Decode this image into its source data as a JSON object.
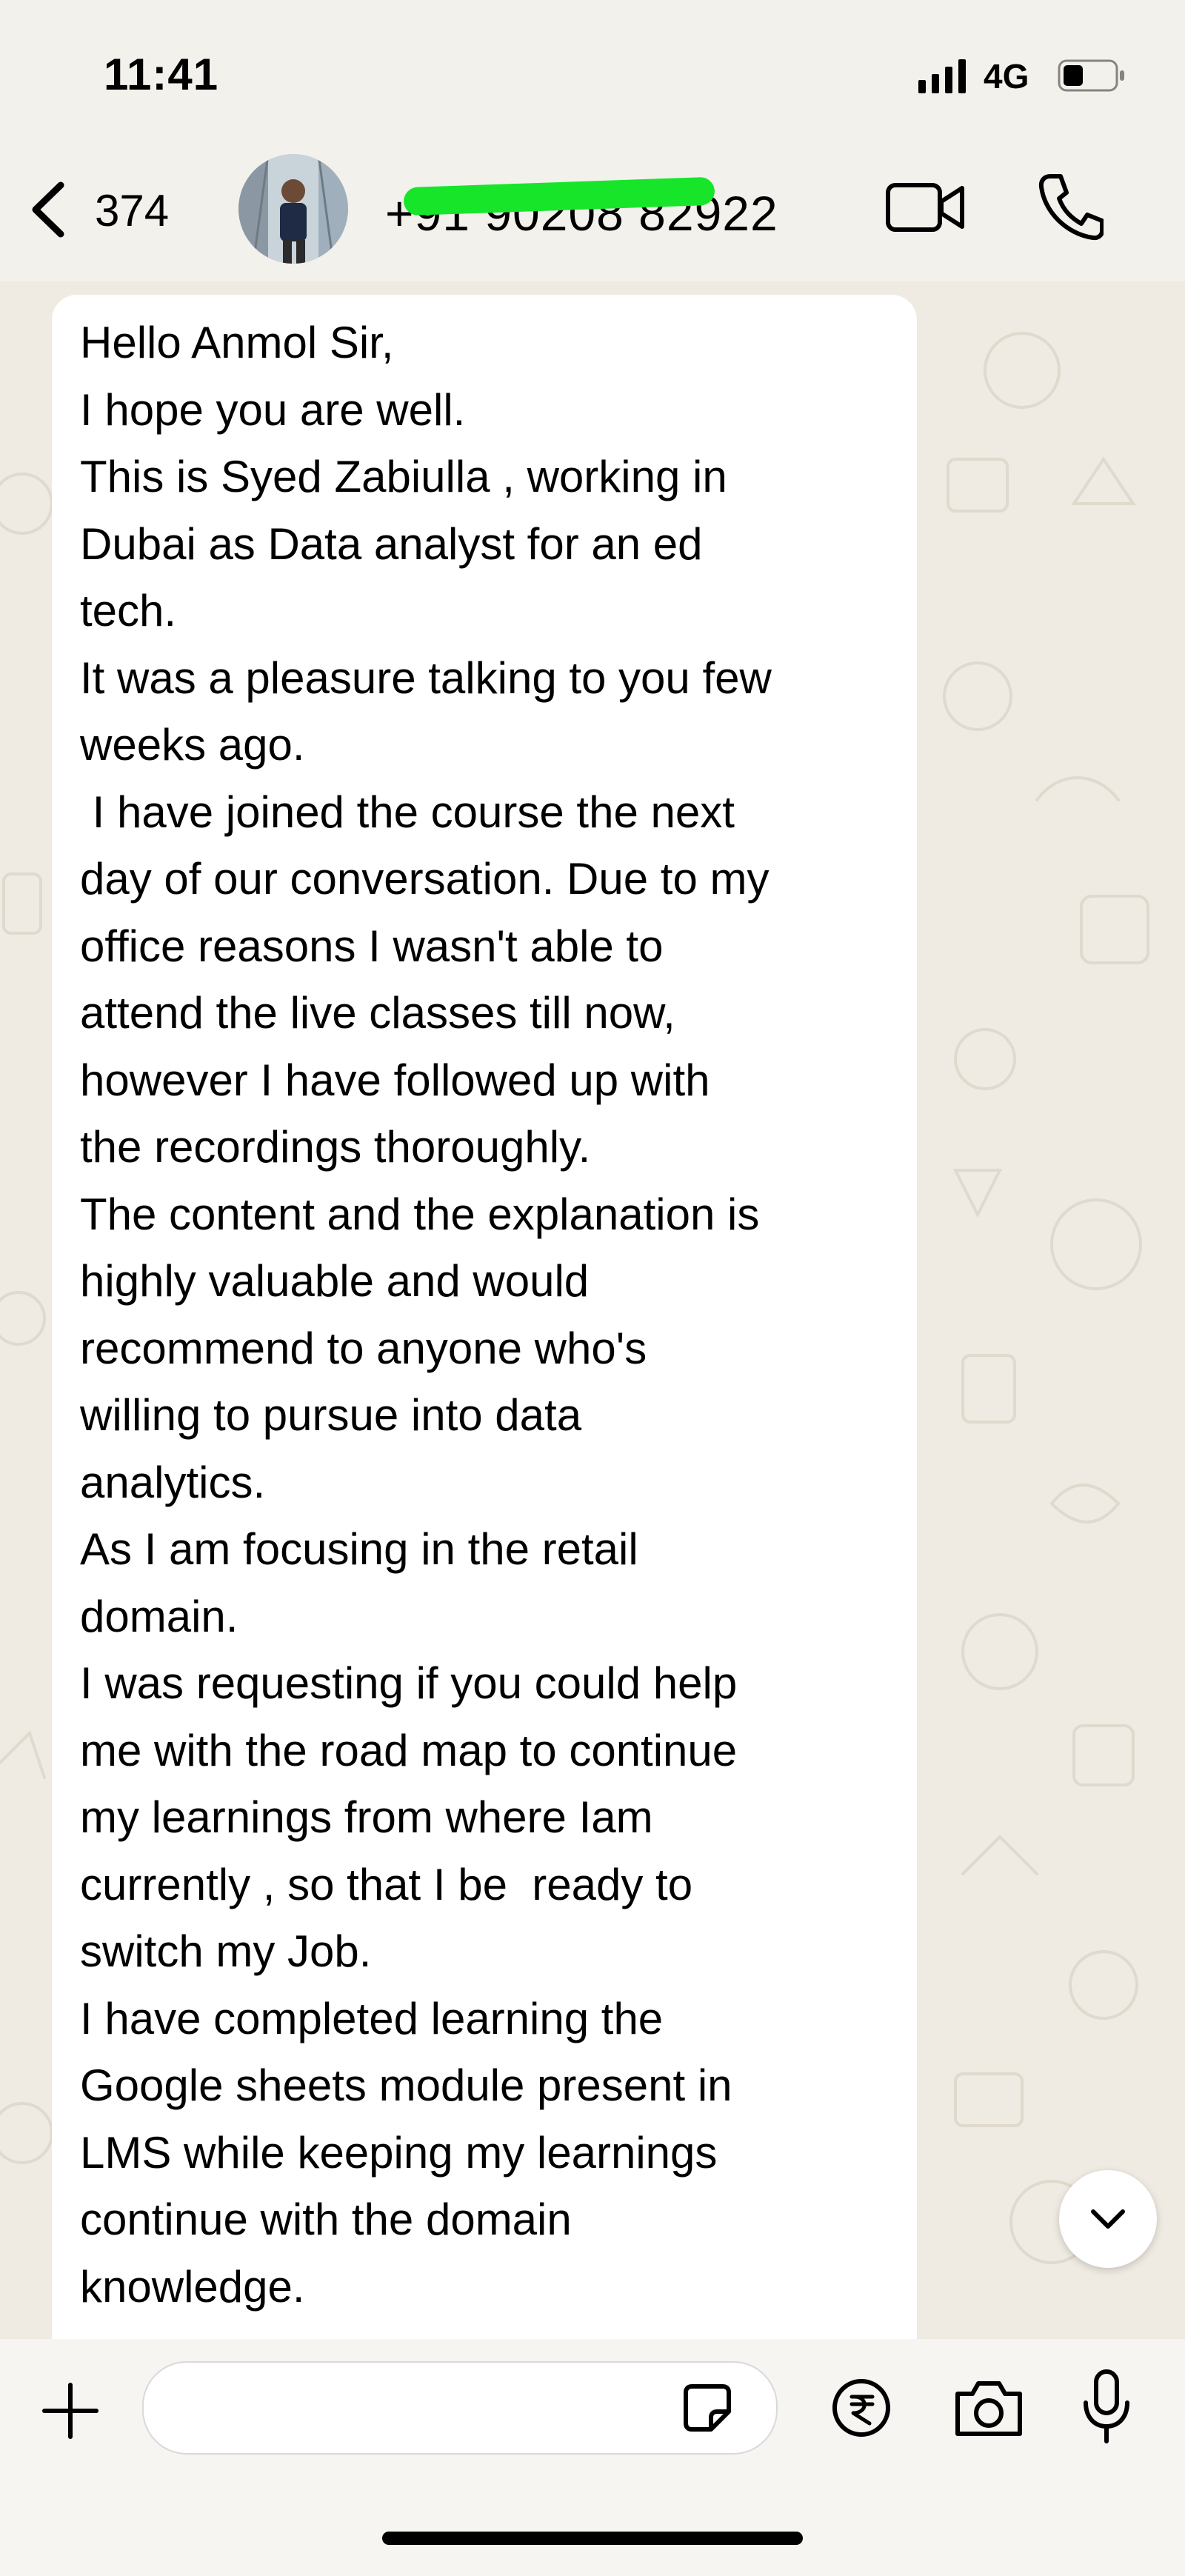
{
  "status_bar": {
    "time": "11:41",
    "network": "4G",
    "icons": [
      "signal-icon",
      "battery-icon"
    ]
  },
  "chat_header": {
    "unread_count": "374",
    "contact_phone": "+91 90208 82922",
    "icons": [
      "back-chevron-icon",
      "video-call-icon",
      "voice-call-icon"
    ]
  },
  "message": {
    "text": "Hello Anmol Sir,\nI hope you are well.\nThis is Syed Zabiulla , working in\nDubai as Data analyst for an ed\ntech.\nIt was a pleasure talking to you few\nweeks ago.\n I have joined the course the next\nday of our conversation. Due to my\noffice reasons I wasn't able to\nattend the live classes till now,\nhowever I have followed up with\nthe recordings thoroughly.\nThe content and the explanation is\nhighly valuable and would\nrecommend to anyone who's\nwilling to pursue into data\nanalytics.\nAs I am focusing in the retail\ndomain.\nI was requesting if you could help\nme with the road map to continue\nmy learnings from where Iam\ncurrently , so that I be  ready to\nswitch my Job.\nI have completed learning the\nGoogle sheets module present in\nLMS while keeping my learnings\ncontinue with the domain\nknowledge."
  },
  "composer": {
    "input_value": "",
    "icons": [
      "plus-icon",
      "sticker-icon",
      "rupee-payment-icon",
      "camera-icon",
      "microphone-icon"
    ]
  },
  "colors": {
    "chat_background": "#efeae2",
    "bubble": "#ffffff",
    "header_background": "#f3f1ec",
    "redaction_marker": "#16e52a"
  }
}
